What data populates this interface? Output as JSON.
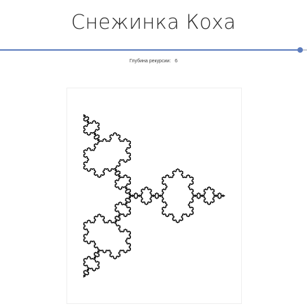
{
  "page": {
    "title": "Снежинка Коха"
  },
  "depth_control": {
    "label": "Глубина рекурсии:",
    "value": 6,
    "min": 0,
    "max": 6,
    "fraction": 1.0
  },
  "colors": {
    "accent": "#5c7cbd",
    "track": "#c7cbd3",
    "stroke": "#000000",
    "background": "#ffffff"
  }
}
